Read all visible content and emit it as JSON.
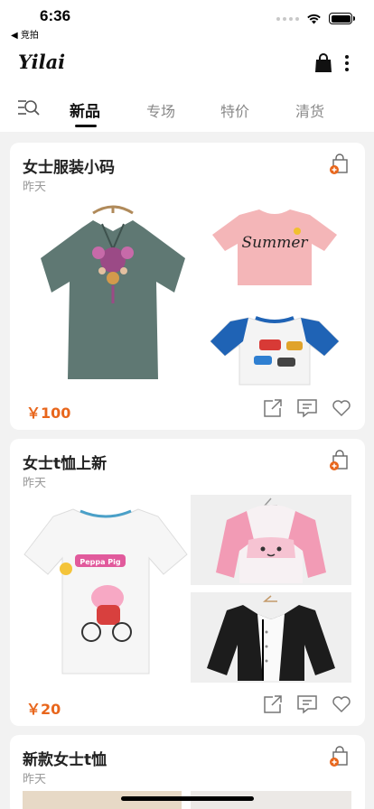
{
  "status": {
    "time": "6:36",
    "back_app": "◀ 竞拍"
  },
  "header": {
    "logo": "Yilai"
  },
  "tabs": [
    {
      "label": "新品",
      "active": true
    },
    {
      "label": "专场",
      "active": false
    },
    {
      "label": "特价",
      "active": false
    },
    {
      "label": "清货",
      "active": false
    }
  ],
  "cards": [
    {
      "title": "女士服装小码",
      "date": "昨天",
      "price": "￥100",
      "image_text": "Summer"
    },
    {
      "title": "女士t恤上新",
      "date": "昨天",
      "price": "￥20",
      "image_text": "Peppa Pig"
    },
    {
      "title": "新款女士t恤",
      "date": "昨天"
    }
  ],
  "colors": {
    "accent": "#e8661c",
    "background": "#f2f2f2"
  }
}
